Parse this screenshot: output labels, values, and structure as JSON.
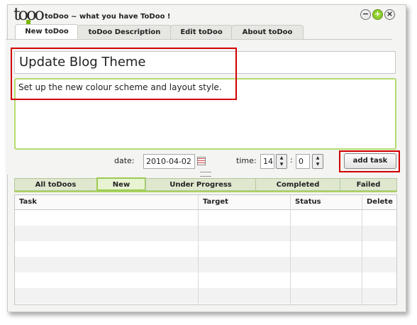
{
  "app": {
    "title": "toDoo ~ what you have ToDoo !",
    "logo_text": "tooo"
  },
  "window_controls": {
    "minimize": "−",
    "maximize": "+",
    "close": "×"
  },
  "top_tabs": [
    "New toDoo",
    "toDoo Description",
    "Edit toDoo",
    "About toDoo"
  ],
  "form": {
    "task_title": "Update Blog Theme",
    "task_description": "Set up the new colour scheme and layout style.",
    "date_label": "date:",
    "date_value": "2010-04-02",
    "time_label": "time:",
    "hour_value": "14",
    "minute_value": "0",
    "colon": ":",
    "add_button": "add task",
    "spin_up": "▲",
    "spin_down": "▼"
  },
  "filter_tabs": [
    "All toDoos",
    "New",
    "Under Progress",
    "Completed",
    "Failed"
  ],
  "table": {
    "columns": [
      "Task",
      "Target",
      "Status",
      "Delete"
    ]
  },
  "colors": {
    "accent_green": "#a8d25e",
    "highlight_red": "#d10000"
  }
}
